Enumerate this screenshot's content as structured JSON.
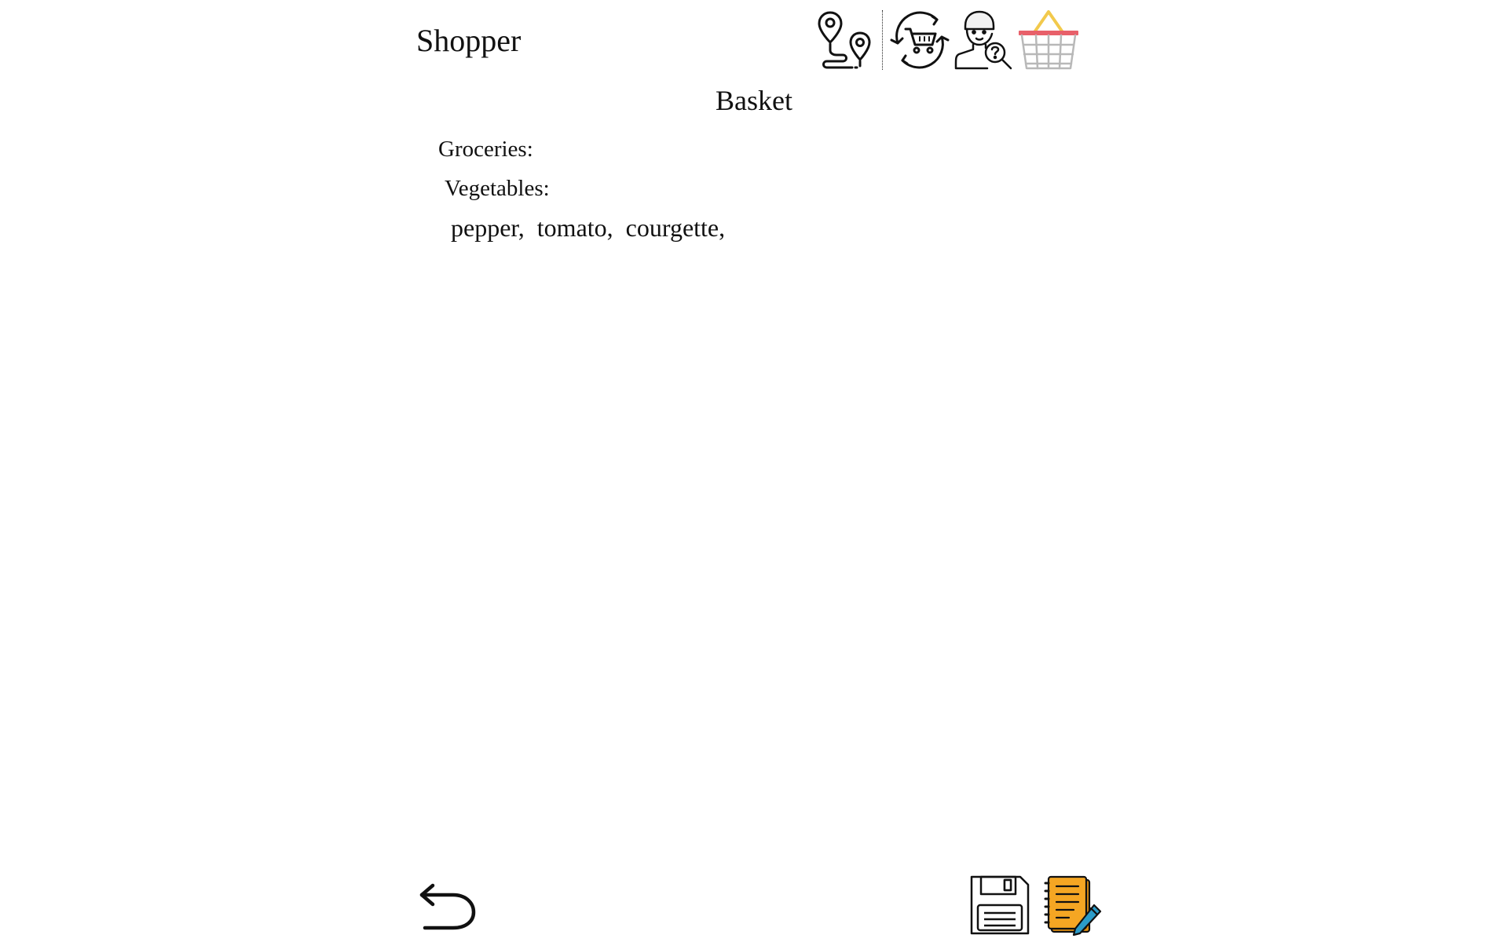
{
  "app": {
    "title": "Shopper"
  },
  "toolbar": {
    "icons": [
      "route-map-icon",
      "cart-refresh-icon",
      "customer-support-icon",
      "basket-icon"
    ]
  },
  "page": {
    "title": "Basket"
  },
  "basket": {
    "category_label": "Groceries:",
    "subcategory_label": "Vegetables:",
    "items": [
      "pepper,",
      "tomato,",
      "courgette,"
    ]
  },
  "footer": {
    "icons": [
      "back-arrow-icon",
      "save-icon",
      "notepad-edit-icon"
    ]
  },
  "colors": {
    "basket_handle": "#f2c94c",
    "basket_rim": "#e8606a",
    "basket_body": "#b8b8b8",
    "notepad": "#f5a623",
    "pencil": "#2b9cc9"
  }
}
